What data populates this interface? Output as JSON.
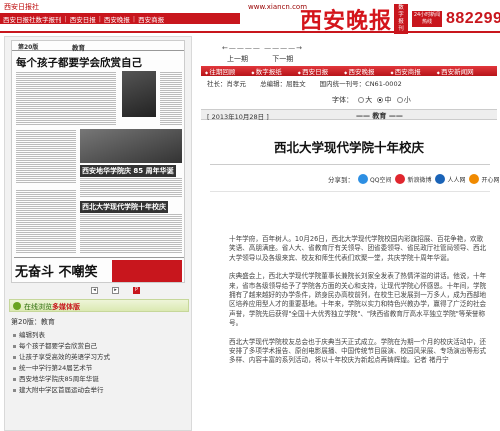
{
  "header": {
    "site_name": "西安日报社",
    "nav": [
      "西安日报社数字报刊",
      "西安日报",
      "西安晚报",
      "西安商报"
    ],
    "url": "www.xiancn.com",
    "logo_text": "西安晚报",
    "logo_tag": "数字报刊",
    "hotline_badge": "24小时新闻热线",
    "hotline_number": "88229999"
  },
  "newspaper_page": {
    "page_label": "第20版",
    "section": "教育",
    "headline_1": "每个孩子都要学会欣赏自己",
    "headline_2": "西安地华学院庆 85 周年华诞",
    "headline_3": "西北大学现代学院十年校庆",
    "ad_slogan": "无奋斗 不嘲笑",
    "tools": [
      "prev-icon",
      "next-icon",
      "pdf-icon"
    ]
  },
  "media_bar": {
    "label": "在线浏览多媒体版",
    "highlight": "多媒体版"
  },
  "edition": {
    "label": "第20版：教育",
    "items": [
      "编辑列表",
      "每个孩子都要学会欣赏自己",
      "让孩子享受高效的英语学习方式",
      "统一中学行第24届艺术节",
      "西安地华学院庆85周年华诞",
      "建大附中学区首届运动会举行"
    ]
  },
  "page_nav": {
    "arrows": "←————  ————→",
    "prev": "上一期",
    "next": "下一期"
  },
  "red_nav": [
    "往期回顾",
    "数字报纸",
    "西安日报",
    "西安晚报",
    "西安商报",
    "西安新闻网"
  ],
  "info_bar": {
    "president": "社长：肖孝元",
    "editor": "总编辑：屈胜文",
    "cn": "国内统一刊号：CN61-0002"
  },
  "font_size": {
    "label": "字体：",
    "options": [
      "大",
      "中",
      "小"
    ],
    "selected": "中"
  },
  "date_bar": {
    "date": "[ 2013年10月28日 ]",
    "section": "—— 教育 ——"
  },
  "article": {
    "title": "西北大学现代学院十年校庆",
    "share_label": "分享到：",
    "share": [
      {
        "name": "qzone",
        "label": "QQ空间",
        "icon": "qzone-icon"
      },
      {
        "name": "weibo",
        "label": "新浪微博",
        "icon": "weibo-icon"
      },
      {
        "name": "renren",
        "label": "人人网",
        "icon": "renren-icon"
      },
      {
        "name": "kaixin",
        "label": "开心网",
        "icon": "kaixin-icon"
      },
      {
        "name": "douban",
        "label": "豆瓣",
        "icon": "douban-icon"
      }
    ],
    "paragraphs": [
      "十年学府，百年树人。10月26日，西北大学现代学院校园内彩旗招展、百花争艳，欢歌笑语、高朋满座。省人大、省教育厅有关领导、团省委领导、省民政厅社管局领导、西北大学领导以及各级来宾、校友和师生代表们欢聚一堂，共庆学院十周年华诞。",
      "庆典盛会上，西北大学现代学院董事长兼院长刘家全发表了热情洋溢的讲话。他说，十年来，省市各级领导给予了学院各方面的关心和支持，让现代学院心怀感恩。十年间，学院拥有了越来越好的办学条件，跻身民办高校前列，在校生已发展到一万多人，成为西部地区培养应用型人才的重要基地。十年来，学院以实力和特色兴教办学，赢得了广泛的社会声誉，学院先后获得\"全国十大优秀独立学院\"、\"陕西省教育厅高水平独立学院\"等荣誉称号。",
      "西北大学现代学院校友总会也于庆典当天正式成立。学院在为期一个月的校庆活动中，还安排了多项学术报告、原创电影展播、中国传统节目展演、校园风采展、专场演出等形式多样、内容丰富的系列活动，将以十年校庆为新起点再铸辉煌。记者 褚丹宁"
    ]
  }
}
